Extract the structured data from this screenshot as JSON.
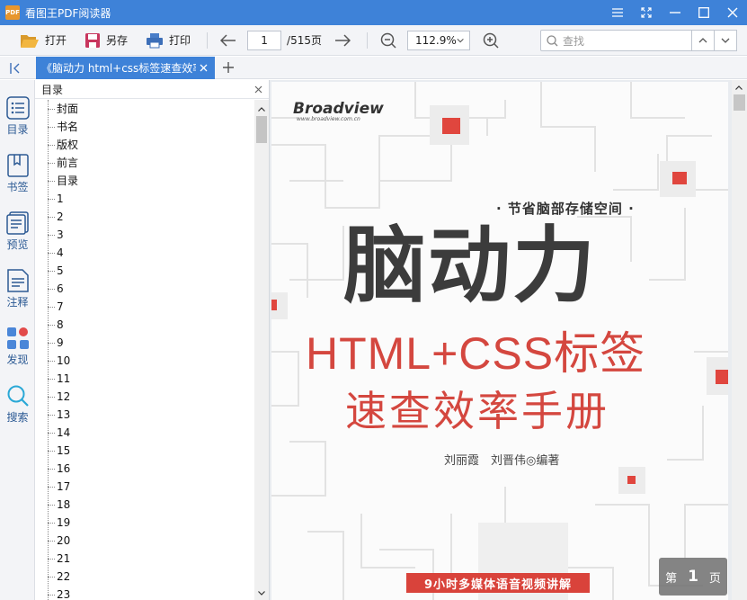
{
  "app": {
    "title": "看图王PDF阅读器",
    "logo_text": "PDF"
  },
  "toolbar": {
    "open_label": "打开",
    "save_as_label": "另存",
    "print_label": "打印",
    "current_page": "1",
    "page_total": "/515页",
    "zoom": "112.9%",
    "search_placeholder": "查找"
  },
  "tab": {
    "title": "《脑动力 html+css标签速查效率"
  },
  "rail": {
    "items": [
      {
        "label": "目录",
        "icon": "toc-list-icon"
      },
      {
        "label": "书签",
        "icon": "bookmark-icon"
      },
      {
        "label": "预览",
        "icon": "thumbnails-icon"
      },
      {
        "label": "注释",
        "icon": "annotation-icon"
      },
      {
        "label": "发现",
        "icon": "discover-icon"
      },
      {
        "label": "搜索",
        "icon": "search-icon"
      }
    ]
  },
  "toc": {
    "title": "目录",
    "items": [
      "封面",
      "书名",
      "版权",
      "前言",
      "目录",
      "1",
      "2",
      "3",
      "4",
      "5",
      "6",
      "7",
      "8",
      "9",
      "10",
      "11",
      "12",
      "13",
      "14",
      "15",
      "16",
      "17",
      "18",
      "19",
      "20",
      "21",
      "22",
      "23"
    ]
  },
  "cover": {
    "brand": "Broadview",
    "brand_url": "www.broadview.com.cn",
    "tagline": "· 节省脑部存储空间 ·",
    "title": "脑动力",
    "subtitle_line1": "HTML+CSS标签",
    "subtitle_line2": "速查效率手册",
    "authors": "刘丽霞　刘晋伟◎编著",
    "banner": "9小时多媒体语音视频讲解"
  },
  "page_indicator": {
    "prefix": "第",
    "number": "1",
    "suffix": "页"
  },
  "colors": {
    "accent": "#3e82d8",
    "cover_red": "#d4473f"
  }
}
